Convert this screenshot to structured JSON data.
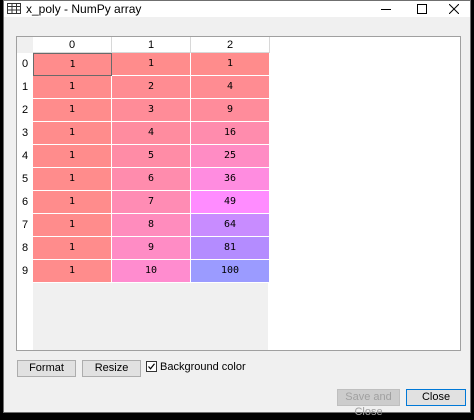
{
  "window": {
    "title": "x_poly - NumPy array",
    "icon": "table-grid-icon"
  },
  "table": {
    "columns": [
      "0",
      "1",
      "2"
    ],
    "rows": [
      "0",
      "1",
      "2",
      "3",
      "4",
      "5",
      "6",
      "7",
      "8",
      "9"
    ],
    "cells": [
      [
        "1",
        "1",
        "1"
      ],
      [
        "1",
        "2",
        "4"
      ],
      [
        "1",
        "3",
        "9"
      ],
      [
        "1",
        "4",
        "16"
      ],
      [
        "1",
        "5",
        "25"
      ],
      [
        "1",
        "6",
        "36"
      ],
      [
        "1",
        "7",
        "49"
      ],
      [
        "1",
        "8",
        "64"
      ],
      [
        "1",
        "9",
        "81"
      ],
      [
        "1",
        "10",
        "100"
      ]
    ],
    "cell_colors": [
      [
        "#ff8c8c",
        "#ff8c8c",
        "#ff8c8c"
      ],
      [
        "#ff8c8c",
        "#ff8c92",
        "#ff8c92"
      ],
      [
        "#ff8c8c",
        "#ff8c98",
        "#ff8c9b"
      ],
      [
        "#ff8c8c",
        "#ff8c9f",
        "#ff8cad"
      ],
      [
        "#ff8c8c",
        "#ff8ca6",
        "#ff8cc4"
      ],
      [
        "#ff8c8c",
        "#ff8cad",
        "#ff8ce0"
      ],
      [
        "#ff8c8c",
        "#ff8cb4",
        "#ff8cff"
      ],
      [
        "#ff8c8c",
        "#ff8cbd",
        "#c88cff"
      ],
      [
        "#ff8c8c",
        "#ff8cc5",
        "#b48cff"
      ],
      [
        "#ff8c8c",
        "#ff8ccf",
        "#9b9bff"
      ]
    ],
    "selected_cell": "0,0"
  },
  "controls": {
    "format_label": "Format",
    "resize_label": "Resize",
    "background_color_label": "Background color",
    "background_color_checked": true,
    "save_close_label": "Save and Close",
    "close_label": "Close"
  }
}
